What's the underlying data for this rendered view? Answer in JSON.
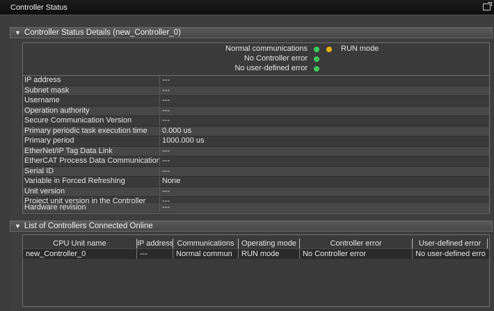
{
  "window": {
    "title": "Controller Status"
  },
  "status_section": {
    "title": "Controller Status Details (new_Controller_0)",
    "lines": [
      {
        "label": "Normal communications",
        "mode": "RUN mode"
      },
      {
        "label": "No Controller error"
      },
      {
        "label": "No user-defined error"
      }
    ],
    "colors": {
      "ok": "#3dc85c",
      "run": "#e6b218"
    }
  },
  "details": [
    {
      "key": "IP address",
      "value": "---"
    },
    {
      "key": "Subnet mask",
      "value": "---"
    },
    {
      "key": "Username",
      "value": "---"
    },
    {
      "key": "Operation authority",
      "value": "---"
    },
    {
      "key": "Secure Communication Version",
      "value": "---"
    },
    {
      "key": "Primary periodic task execution time",
      "value": "0.000 us"
    },
    {
      "key": "Primary period",
      "value": "1000.000 us"
    },
    {
      "key": "EtherNet/IP Tag Data Link",
      "value": "---"
    },
    {
      "key": "EtherCAT Process Data Communications",
      "value": "---"
    },
    {
      "key": "Serial ID",
      "value": "---"
    },
    {
      "key": "Variable in Forced Refreshing",
      "value": "None"
    },
    {
      "key": "Unit version",
      "value": "---"
    },
    {
      "key": "Project unit version in the Controller",
      "value": "---"
    },
    {
      "key": "Hardware revision",
      "value": "---"
    }
  ],
  "online_section": {
    "title": "List of Controllers Connected Online",
    "columns": [
      "CPU Unit name",
      "IP address",
      "Communications",
      "Operating mode",
      "Controller error",
      "User-defined error"
    ],
    "rows": [
      [
        "new_Controller_0",
        "---",
        "Normal commun",
        "RUN mode",
        "No Controller error",
        "No user-defined erro"
      ]
    ]
  }
}
